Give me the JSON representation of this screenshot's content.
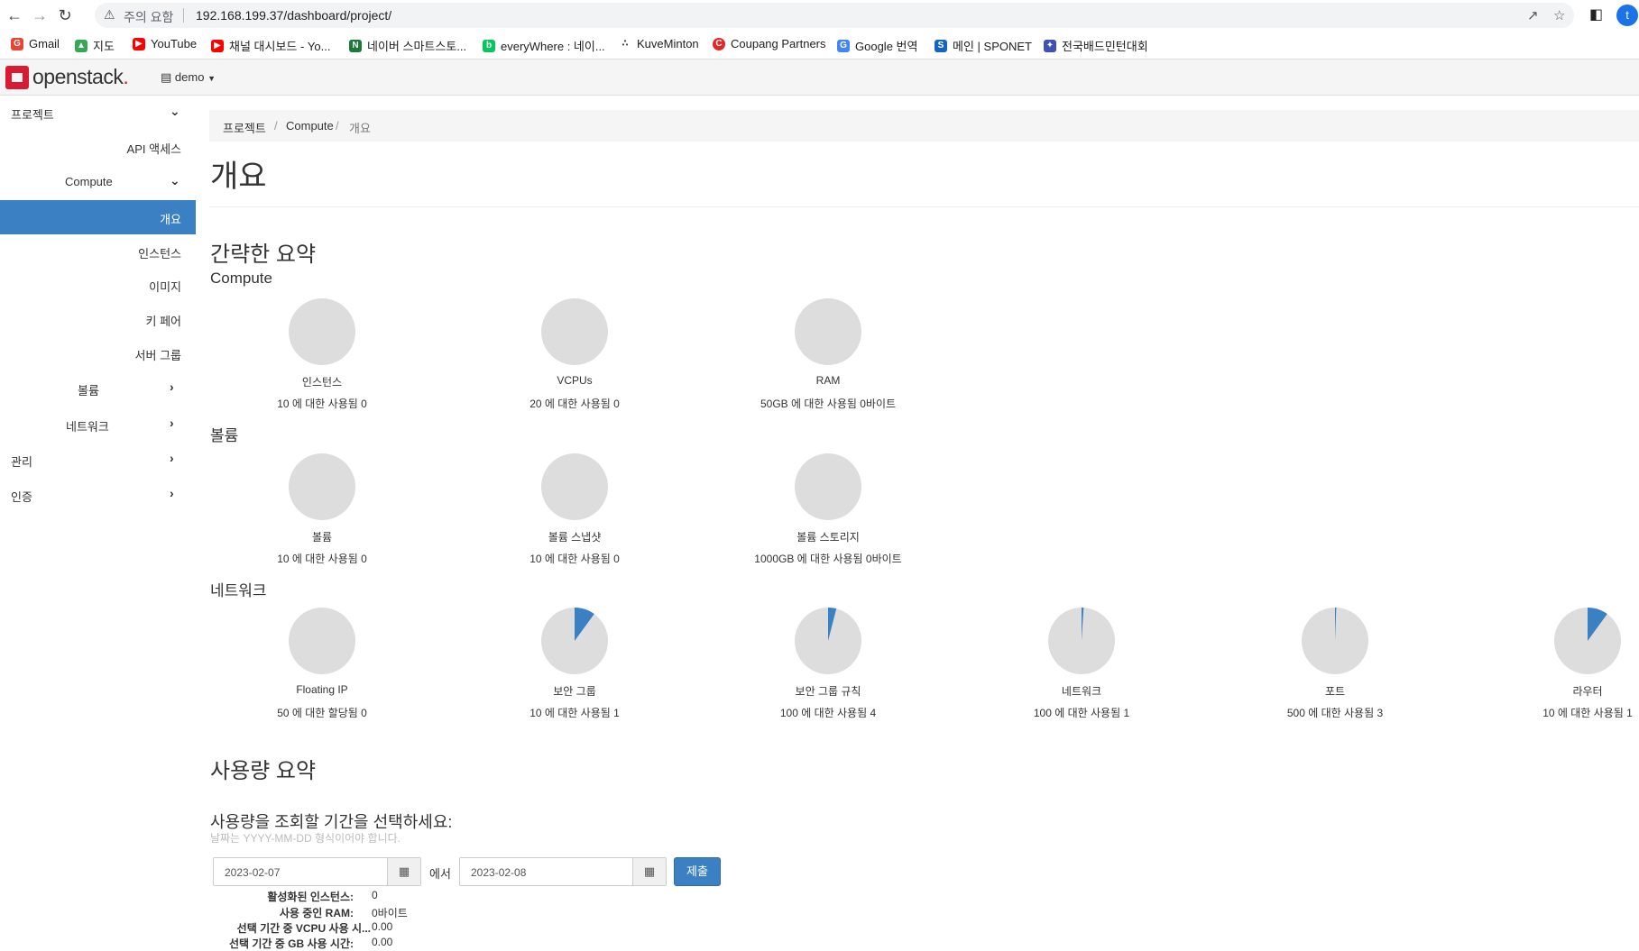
{
  "browser": {
    "warning_label": "주의 요함",
    "url": "192.168.199.37/dashboard/project/",
    "profile_initial": "t",
    "bookmarks": [
      {
        "label": "Gmail",
        "icon": "gmail-icon",
        "color": "#ea4335"
      },
      {
        "label": "지도",
        "icon": "maps-icon",
        "color": "#34a853"
      },
      {
        "label": "YouTube",
        "icon": "youtube-icon",
        "color": "#ff0000"
      },
      {
        "label": "채널 대시보드 - Yo...",
        "icon": "youtube-icon",
        "color": "#ff0000"
      },
      {
        "label": "네이버 스마트스토...",
        "icon": "naver-smartstore-icon",
        "color": "#1a7a3a"
      },
      {
        "label": "everyWhere : 네이...",
        "icon": "naver-blog-icon",
        "color": "#03c75a"
      },
      {
        "label": "KuveMinton",
        "icon": "kuveminton-icon",
        "color": "#333333"
      },
      {
        "label": "Coupang Partners",
        "icon": "coupang-icon",
        "color": "#e52528"
      },
      {
        "label": "Google 번역",
        "icon": "google-translate-icon",
        "color": "#4285f4"
      },
      {
        "label": "메인 | SPONET",
        "icon": "sponet-icon",
        "color": "#1565c0"
      },
      {
        "label": "전국배드민턴대회",
        "icon": "badminton-icon",
        "color": "#3f51b5"
      }
    ]
  },
  "header": {
    "logo_text": "openstack",
    "logo_dot": ".",
    "project": "demo"
  },
  "sidebar": {
    "project": "프로젝트",
    "api_access": "API 액세스",
    "compute": "Compute",
    "overview": "개요",
    "instances": "인스턴스",
    "images": "이미지",
    "key_pairs": "키 페어",
    "server_groups": "서버 그룹",
    "volumes": "볼륨",
    "network": "네트워크",
    "admin": "관리",
    "identity": "인증"
  },
  "breadcrumb": [
    "프로젝트",
    "Compute",
    "개요"
  ],
  "breadcrumb_sep": "/",
  "page_title": "개요",
  "limit_summary": {
    "heading": "간략한 요약",
    "sections": [
      {
        "title": "Compute",
        "items": [
          {
            "label": "인스턴스",
            "sub": "10 에 대한 사용됨 0",
            "used": 0,
            "limit": 10
          },
          {
            "label": "VCPUs",
            "sub": "20 에 대한 사용됨 0",
            "used": 0,
            "limit": 20
          },
          {
            "label": "RAM",
            "sub": "50GB 에 대한 사용됨 0바이트",
            "used": 0,
            "limit": 50
          }
        ]
      },
      {
        "title": "볼륨",
        "items": [
          {
            "label": "볼륨",
            "sub": "10 에 대한 사용됨 0",
            "used": 0,
            "limit": 10
          },
          {
            "label": "볼륨 스냅샷",
            "sub": "10 에 대한 사용됨 0",
            "used": 0,
            "limit": 10
          },
          {
            "label": "볼륨 스토리지",
            "sub": "1000GB 에 대한 사용됨 0바이트",
            "used": 0,
            "limit": 1000
          }
        ]
      },
      {
        "title": "네트워크",
        "items": [
          {
            "label": "Floating IP",
            "sub": "50 에 대한 할당됨 0",
            "used": 0,
            "limit": 50
          },
          {
            "label": "보안 그룹",
            "sub": "10 에 대한 사용됨 1",
            "used": 1,
            "limit": 10
          },
          {
            "label": "보안 그룹 규칙",
            "sub": "100 에 대한 사용됨 4",
            "used": 4,
            "limit": 100
          },
          {
            "label": "네트워크",
            "sub": "100 에 대한 사용됨 1",
            "used": 1,
            "limit": 100
          },
          {
            "label": "포트",
            "sub": "500 에 대한 사용됨 3",
            "used": 3,
            "limit": 500
          },
          {
            "label": "라우터",
            "sub": "10 에 대한 사용됨 1",
            "used": 1,
            "limit": 10
          }
        ]
      }
    ],
    "pie_bg": "#dddddd",
    "pie_fill": "#3c80c4"
  },
  "usage": {
    "heading": "사용량 요약",
    "question": "사용량을 조회할 기간을 선택하세요:",
    "hint": "날짜는 YYYY-MM-DD 형식이어야 합니다.",
    "start": "2023-02-07",
    "from_label": "에서",
    "end": "2023-02-08",
    "submit": "제출",
    "stats": [
      {
        "key": "활성화된 인스턴스:",
        "value": "0"
      },
      {
        "key": "사용 중인 RAM:",
        "value": "0바이트"
      },
      {
        "key": "선택 기간 중 VCPU 사용 시...",
        "value": "0.00"
      },
      {
        "key": "선택 기간 중 GB 사용 시간:",
        "value": "0.00"
      }
    ]
  }
}
